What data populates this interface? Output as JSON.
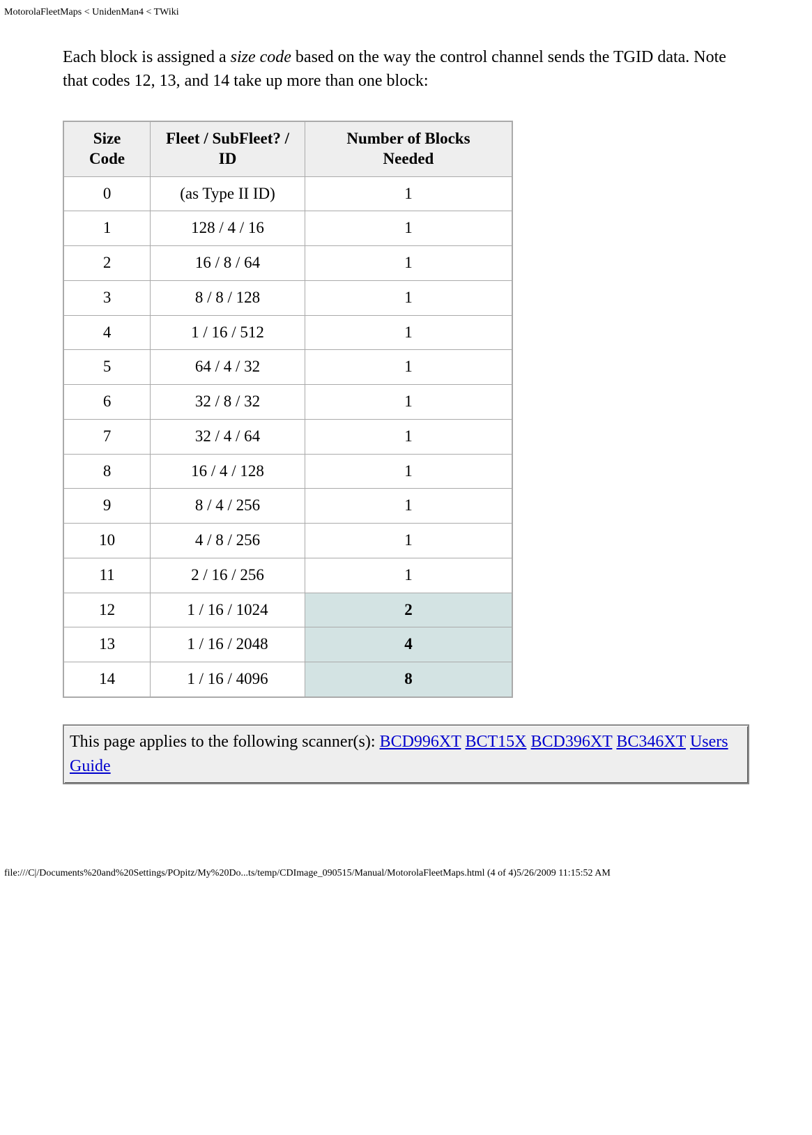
{
  "headerPath": "MotorolaFleetMaps < UnidenMan4 < TWiki",
  "intro_pre": "Each block is assigned a ",
  "intro_italic": "size code",
  "intro_post": " based on the way the control channel sends the TGID data. Note that codes 12, 13, and 14 take up more than one block:",
  "table": {
    "headers": {
      "c1a": "Size",
      "c1b": "Code",
      "c2a": "Fleet / SubFleet? /",
      "c2b": "ID",
      "c3a": "Number of Blocks",
      "c3b": "Needed"
    },
    "rows": [
      {
        "c1": "0",
        "c2": "(as Type II ID)",
        "c3": "1",
        "hl": false
      },
      {
        "c1": "1",
        "c2": "128 / 4 / 16",
        "c3": "1",
        "hl": false
      },
      {
        "c1": "2",
        "c2": "16 / 8 / 64",
        "c3": "1",
        "hl": false
      },
      {
        "c1": "3",
        "c2": "8 / 8 / 128",
        "c3": "1",
        "hl": false
      },
      {
        "c1": "4",
        "c2": "1 / 16 / 512",
        "c3": "1",
        "hl": false
      },
      {
        "c1": "5",
        "c2": "64 / 4 / 32",
        "c3": "1",
        "hl": false
      },
      {
        "c1": "6",
        "c2": "32 / 8 / 32",
        "c3": "1",
        "hl": false
      },
      {
        "c1": "7",
        "c2": "32 / 4 / 64",
        "c3": "1",
        "hl": false
      },
      {
        "c1": "8",
        "c2": "16 / 4 / 128",
        "c3": "1",
        "hl": false
      },
      {
        "c1": "9",
        "c2": "8 / 4 / 256",
        "c3": "1",
        "hl": false
      },
      {
        "c1": "10",
        "c2": "4 / 8 / 256",
        "c3": "1",
        "hl": false
      },
      {
        "c1": "11",
        "c2": "2 / 16 / 256",
        "c3": "1",
        "hl": false
      },
      {
        "c1": "12",
        "c2": "1 / 16 / 1024",
        "c3": "2",
        "hl": true
      },
      {
        "c1": "13",
        "c2": "1 / 16 / 2048",
        "c3": "4",
        "hl": true
      },
      {
        "c1": "14",
        "c2": "1 / 16 / 4096",
        "c3": "8",
        "hl": true
      }
    ]
  },
  "applies": {
    "lead": "This page applies to the following scanner(s): ",
    "links": [
      "BCD996XT",
      "BCT15X",
      "BCD396XT",
      "BC346XT",
      "Users Guide"
    ]
  },
  "footerPath": "file:///C|/Documents%20and%20Settings/POpitz/My%20Do...ts/temp/CDImage_090515/Manual/MotorolaFleetMaps.html (4 of 4)5/26/2009 11:15:52 AM"
}
